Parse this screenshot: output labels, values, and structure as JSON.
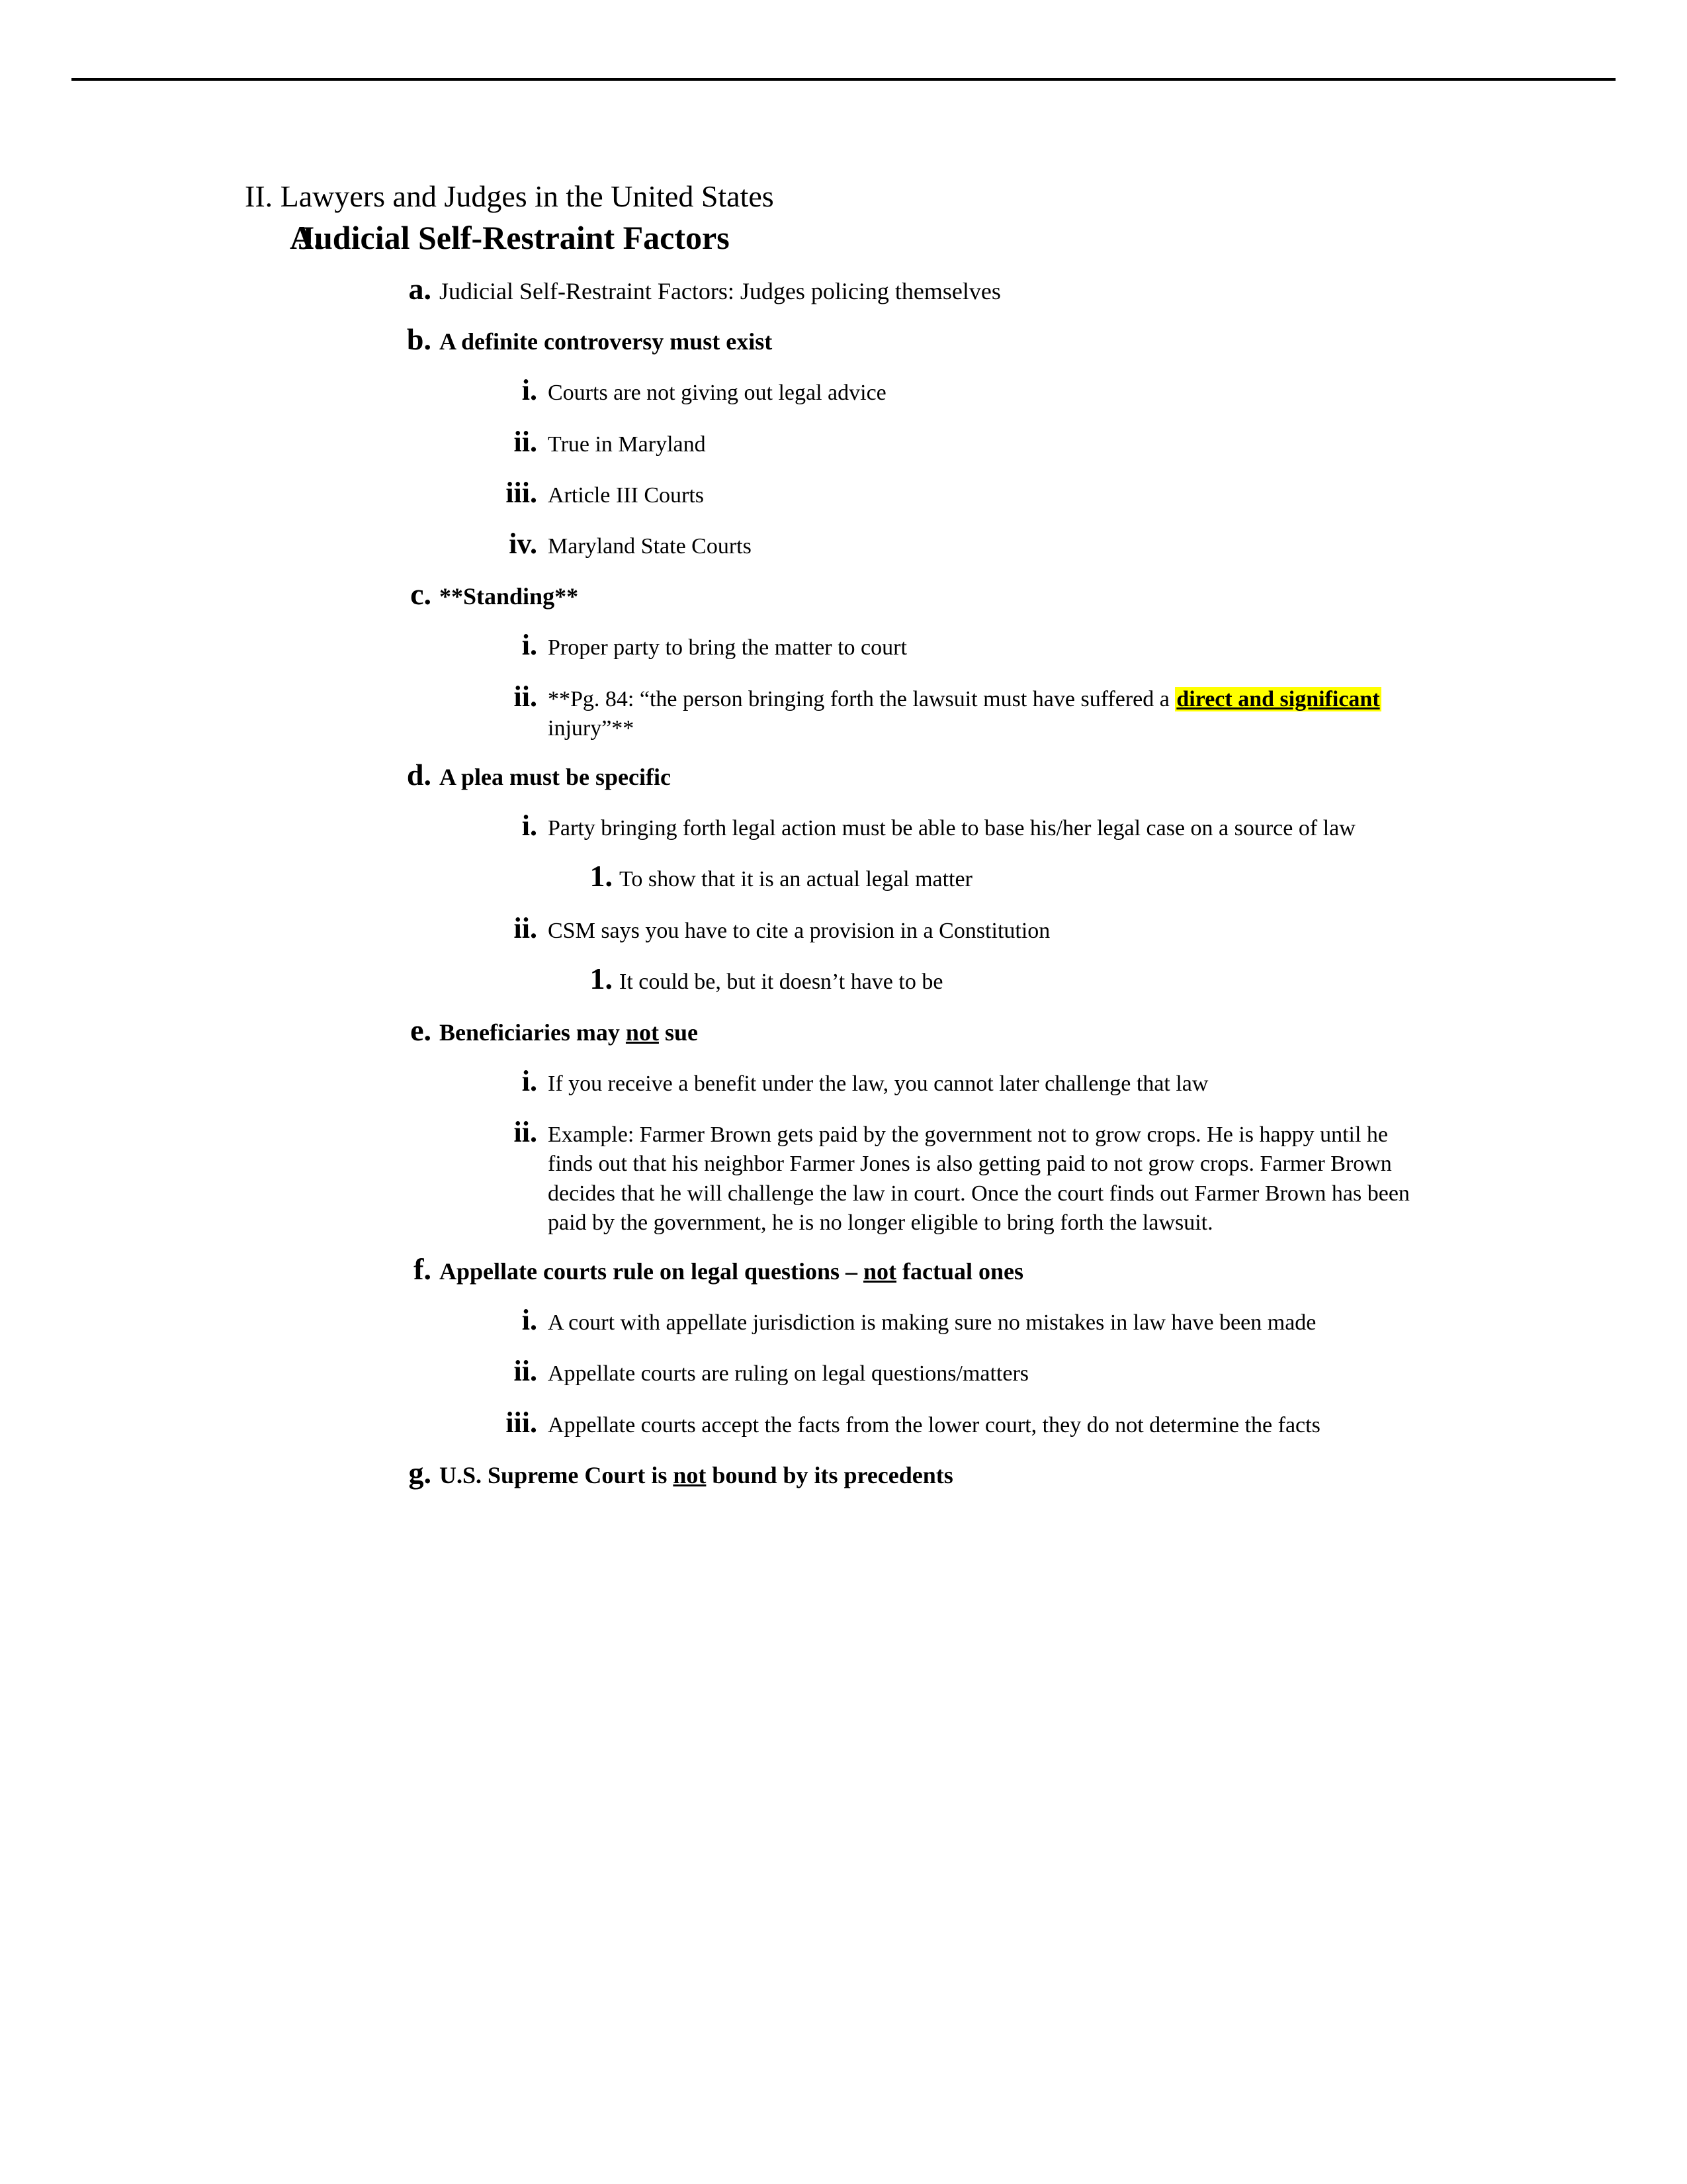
{
  "document": {
    "has_header_rule": true,
    "highlight_color": "#ffff00",
    "background_color": "#ffffff",
    "text_color": "#000000"
  },
  "outline": {
    "section_roman": "II. Lawyers and Judges in the United States",
    "section_alpha_marker": "A.",
    "section_alpha_title": "Judicial Self-Restraint Factors",
    "items": {
      "a": {
        "marker": "a.",
        "text": "Judicial Self-Restraint Factors: Judges policing themselves"
      },
      "b": {
        "marker": "b.",
        "text": "A definite controversy must exist",
        "sub": {
          "i": {
            "marker": "i.",
            "text": "Courts are not giving out legal advice"
          },
          "ii": {
            "marker": "ii.",
            "text": "True in Maryland"
          },
          "iii": {
            "marker": "iii.",
            "text": "Article III Courts"
          },
          "iv": {
            "marker": "iv.",
            "text": "Maryland State Courts"
          }
        }
      },
      "c": {
        "marker": "c.",
        "text": "**Standing**",
        "sub": {
          "i": {
            "marker": "i.",
            "text": "Proper party to bring the matter to court"
          },
          "ii": {
            "marker": "ii.",
            "text_before": "**Pg. 84: “the person bringing forth the lawsuit must have suffered a ",
            "text_highlight": "direct and significant",
            "text_after": " injury”**"
          }
        }
      },
      "d": {
        "marker": "d.",
        "text": "A plea must be specific",
        "sub": {
          "i": {
            "marker": "i.",
            "text": "Party bringing forth legal action must be able to base his/her legal case on a source of law",
            "sub": {
              "1": {
                "marker": "1.",
                "text": "To show that it is an actual legal matter"
              }
            }
          },
          "ii": {
            "marker": "ii.",
            "text": "CSM says you have to cite a provision in a Constitution",
            "sub": {
              "1": {
                "marker": "1.",
                "text": "It could be, but it doesn’t have to be"
              }
            }
          }
        }
      },
      "e": {
        "marker": "e.",
        "text_before": "Beneficiaries may ",
        "text_underline": "not",
        "text_after": " sue",
        "sub": {
          "i": {
            "marker": "i.",
            "text": "If you receive a benefit under the law, you cannot later challenge that law"
          },
          "ii": {
            "marker": "ii.",
            "text": "Example: Farmer Brown gets paid by the government not to grow crops.  He is happy until he finds out that his neighbor Farmer Jones is also getting paid to not grow crops.  Farmer Brown decides that he will challenge the law in court.  Once the court finds out Farmer Brown has been paid by the government, he is no longer eligible to bring forth the lawsuit."
          }
        }
      },
      "f": {
        "marker": "f.",
        "text_before": "Appellate courts rule on legal questions – ",
        "text_underline": "not",
        "text_after": " factual ones",
        "sub": {
          "i": {
            "marker": "i.",
            "text": "A court with appellate jurisdiction is making sure no mistakes in law have been made"
          },
          "ii": {
            "marker": "ii.",
            "text": "Appellate courts are ruling on legal questions/matters"
          },
          "iii": {
            "marker": "iii.",
            "text": "Appellate courts accept the facts from the lower court, they do not determine the facts"
          }
        }
      },
      "g": {
        "marker": "g.",
        "text_before": "U.S. Supreme Court is ",
        "text_underline": "not",
        "text_after": " bound by its precedents"
      }
    }
  }
}
